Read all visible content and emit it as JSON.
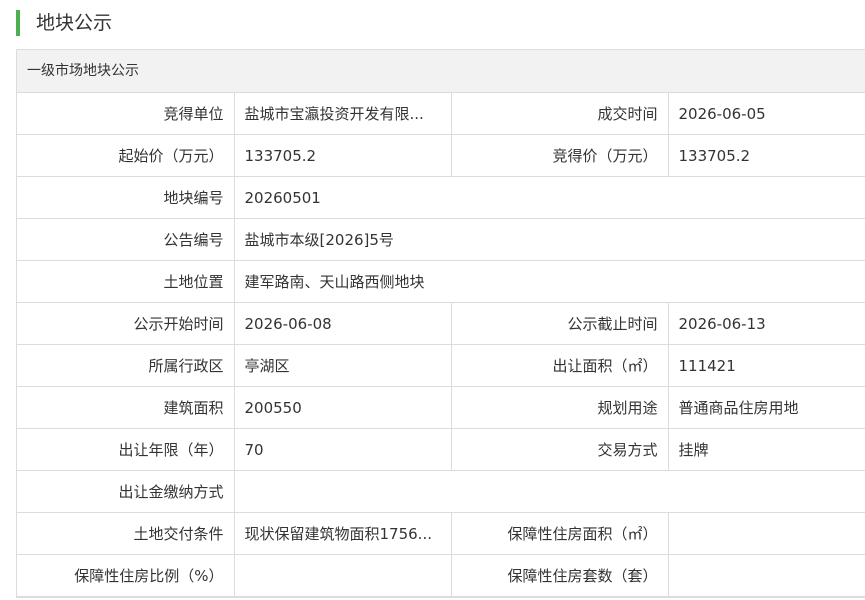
{
  "page": {
    "title": "地块公示"
  },
  "panel": {
    "header": "一级市场地块公示"
  },
  "fields": {
    "bidder_label": "竞得单位",
    "bidder_value": "盐城市宝瀛投资开发有限...",
    "deal_time_label": "成交时间",
    "deal_time_value": "2026-06-05",
    "start_price_label": "起始价（万元）",
    "start_price_value": "133705.2",
    "win_price_label": "竞得价（万元）",
    "win_price_value": "133705.2",
    "parcel_no_label": "地块编号",
    "parcel_no_value": "20260501",
    "notice_no_label": "公告编号",
    "notice_no_value": "盐城市本级[2026]5号",
    "location_label": "土地位置",
    "location_value": "建军路南、天山路西侧地块",
    "notice_start_label": "公示开始时间",
    "notice_start_value": "2026-06-08",
    "notice_end_label": "公示截止时间",
    "notice_end_value": "2026-06-13",
    "district_label": "所属行政区",
    "district_value": "亭湖区",
    "area_label": "出让面积（㎡）",
    "area_value": "111421",
    "building_area_label": "建筑面积",
    "building_area_value": "200550",
    "planned_use_label": "规划用途",
    "planned_use_value": "普通商品住房用地",
    "term_label": "出让年限（年）",
    "term_value": "70",
    "trade_mode_label": "交易方式",
    "trade_mode_value": "挂牌",
    "payment_label": "出让金缴纳方式",
    "payment_value": "",
    "delivery_label": "土地交付条件",
    "delivery_value": "现状保留建筑物面积1756...",
    "aff_area_label": "保障性住房面积（㎡）",
    "aff_area_value": "",
    "aff_ratio_label": "保障性住房比例（%）",
    "aff_ratio_value": "",
    "aff_units_label": "保障性住房套数（套）",
    "aff_units_value": ""
  },
  "colors": {
    "accent": "#4caf50",
    "border": "#dcdcdc",
    "header_bg": "#f2f2f2",
    "text": "#333333"
  }
}
